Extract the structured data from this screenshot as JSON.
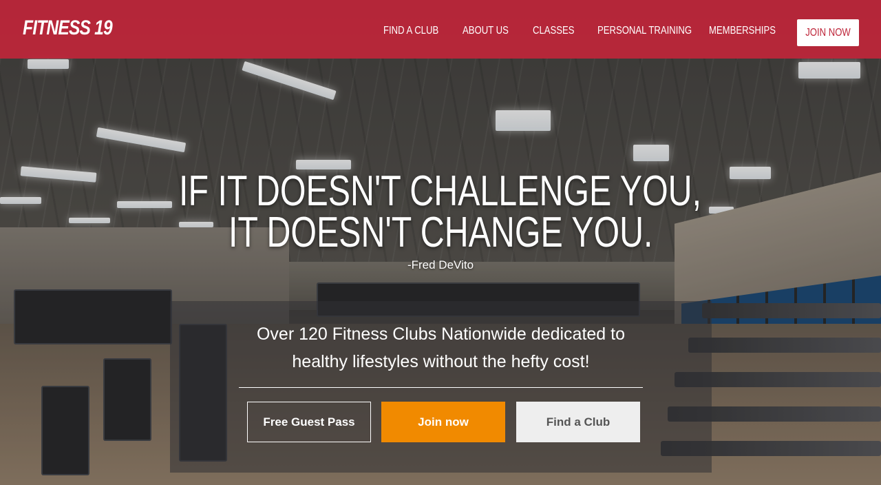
{
  "header": {
    "logo": "FITNESS 19",
    "nav": [
      {
        "label": "FIND A CLUB"
      },
      {
        "label": "ABOUT US"
      },
      {
        "label": "CLASSES"
      },
      {
        "label": "PERSONAL TRAINING"
      },
      {
        "label": "MEMBERSHIPS"
      }
    ],
    "join_label": "JOIN NOW"
  },
  "hero": {
    "headline_line1": "IF IT DOESN'T CHALLENGE YOU,",
    "headline_line2": "IT DOESN'T CHANGE YOU.",
    "author": "-Fred DeVito",
    "tagline_line1": "Over 120 Fitness Clubs Nationwide dedicated to",
    "tagline_line2": "healthy lifestyles without the hefty cost!",
    "buttons": {
      "guest_pass": "Free Guest Pass",
      "join": "Join now",
      "find_club": "Find a Club"
    }
  },
  "colors": {
    "brand_red": "#be263a",
    "join_orange": "#f18a00",
    "find_gray": "#eeeeee"
  }
}
